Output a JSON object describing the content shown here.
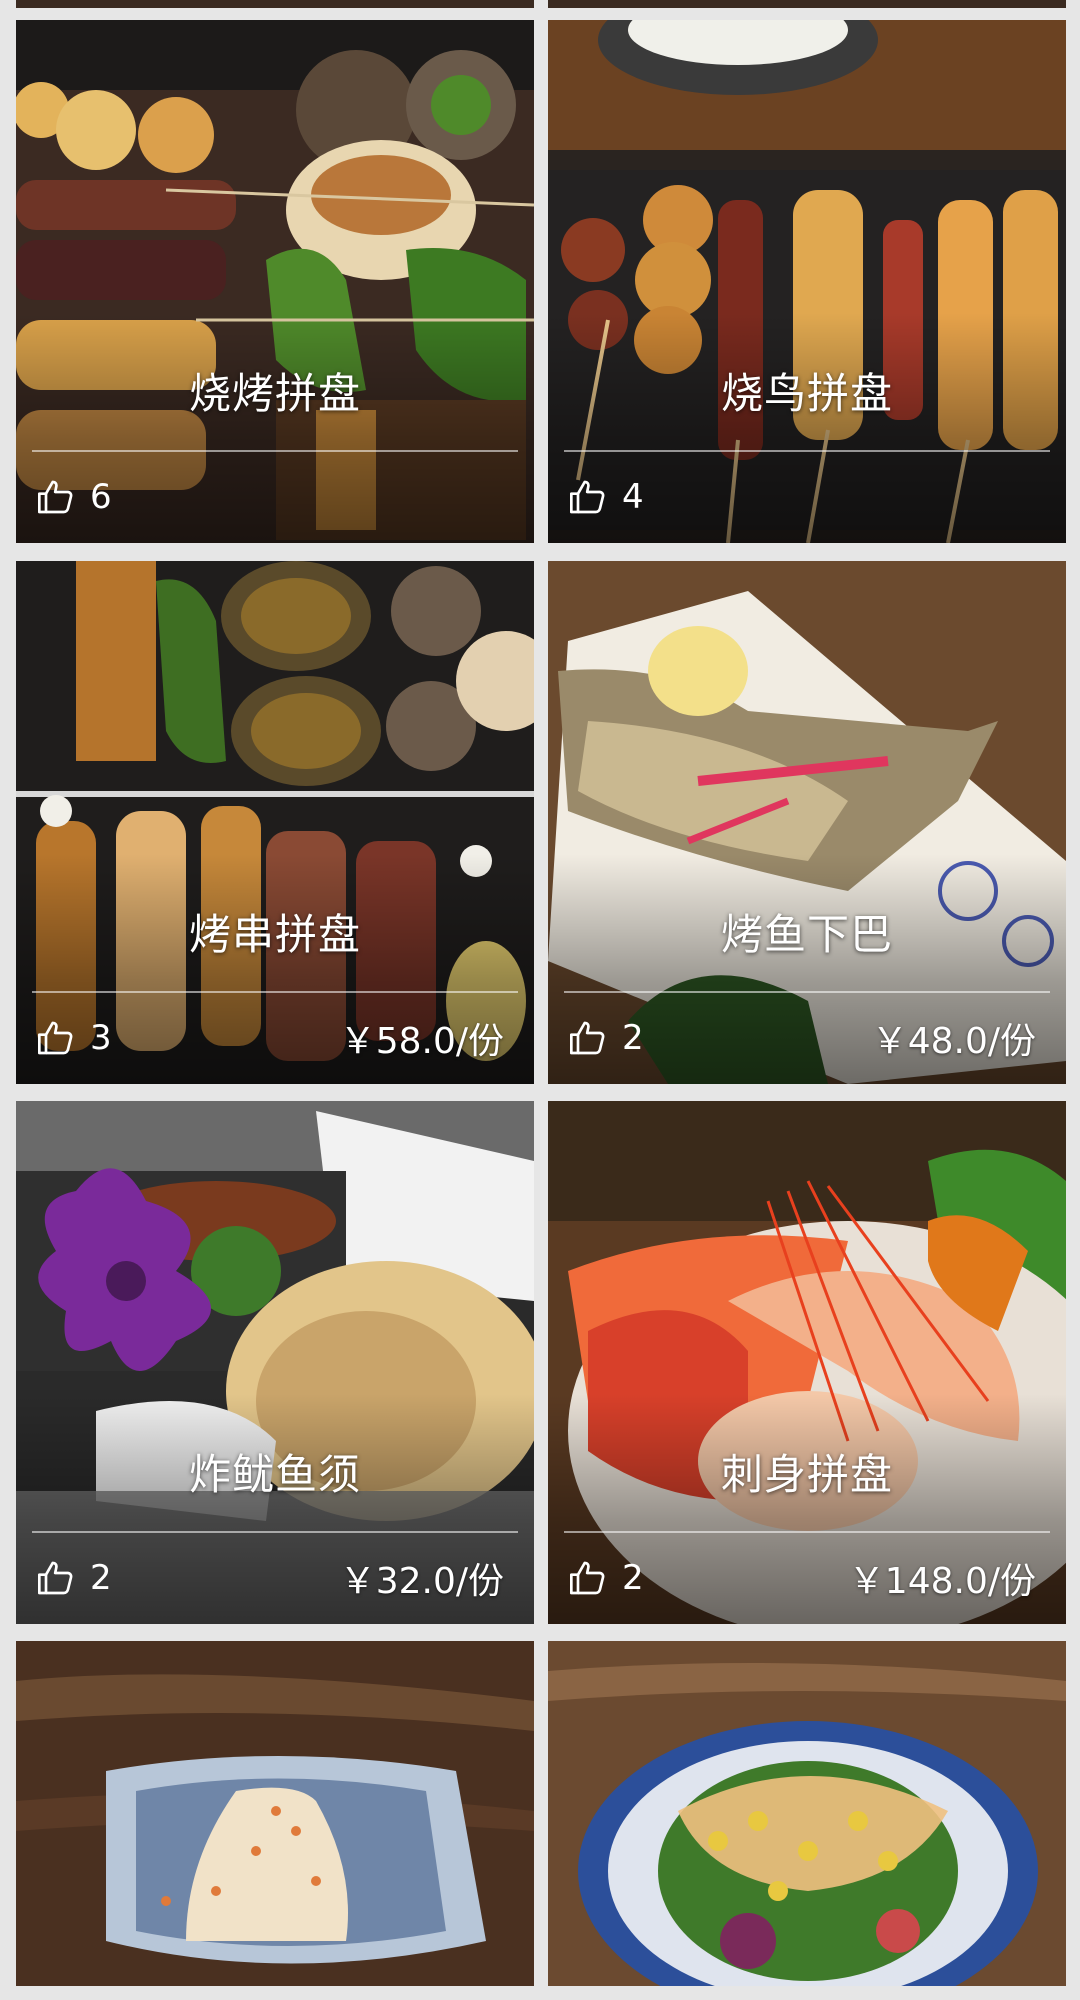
{
  "dishes": [
    {
      "name": "烧烤拼盘",
      "likes": "6",
      "price": "",
      "photo_colors": [
        "#3b2a22",
        "#c98a3a",
        "#4f8a2a",
        "#e8d6b0"
      ]
    },
    {
      "name": "烧鸟拼盘",
      "likes": "4",
      "price": "",
      "photo_colors": [
        "#2a2420",
        "#c0722b",
        "#8a2a1e",
        "#e0a850"
      ]
    },
    {
      "name": "烤串拼盘",
      "likes": "3",
      "price": "￥58.0/份",
      "photo_colors": [
        "#1f1d1c",
        "#b5742c",
        "#3e6e22",
        "#7a3528"
      ]
    },
    {
      "name": "烤鱼下巴",
      "likes": "2",
      "price": "￥48.0/份",
      "photo_colors": [
        "#6b4a2e",
        "#f1ece2",
        "#9a8a6a",
        "#e0365e"
      ]
    },
    {
      "name": "炸鱿鱼须",
      "likes": "2",
      "price": "￥32.0/份",
      "photo_colors": [
        "#2a2a2a",
        "#e2c58a",
        "#7a2a9a",
        "#3e7a2a"
      ]
    },
    {
      "name": "刺身拼盘",
      "likes": "2",
      "price": "￥148.0/份",
      "photo_colors": [
        "#5a3a22",
        "#f06a3a",
        "#d8402a",
        "#f3b08a"
      ]
    },
    {
      "name": "",
      "likes": "",
      "price": "",
      "photo_colors": [
        "#4a3020",
        "#b7c6d8",
        "#f1e2c8",
        "#e07a3a"
      ]
    },
    {
      "name": "",
      "likes": "",
      "price": "",
      "photo_colors": [
        "#6b4a30",
        "#2c4f9a",
        "#e8c840",
        "#7a2a5a"
      ]
    }
  ],
  "colors": {
    "background": "#e6e6e6",
    "text": "#ffffff"
  },
  "icons": {
    "like": "thumbs-up-icon"
  }
}
